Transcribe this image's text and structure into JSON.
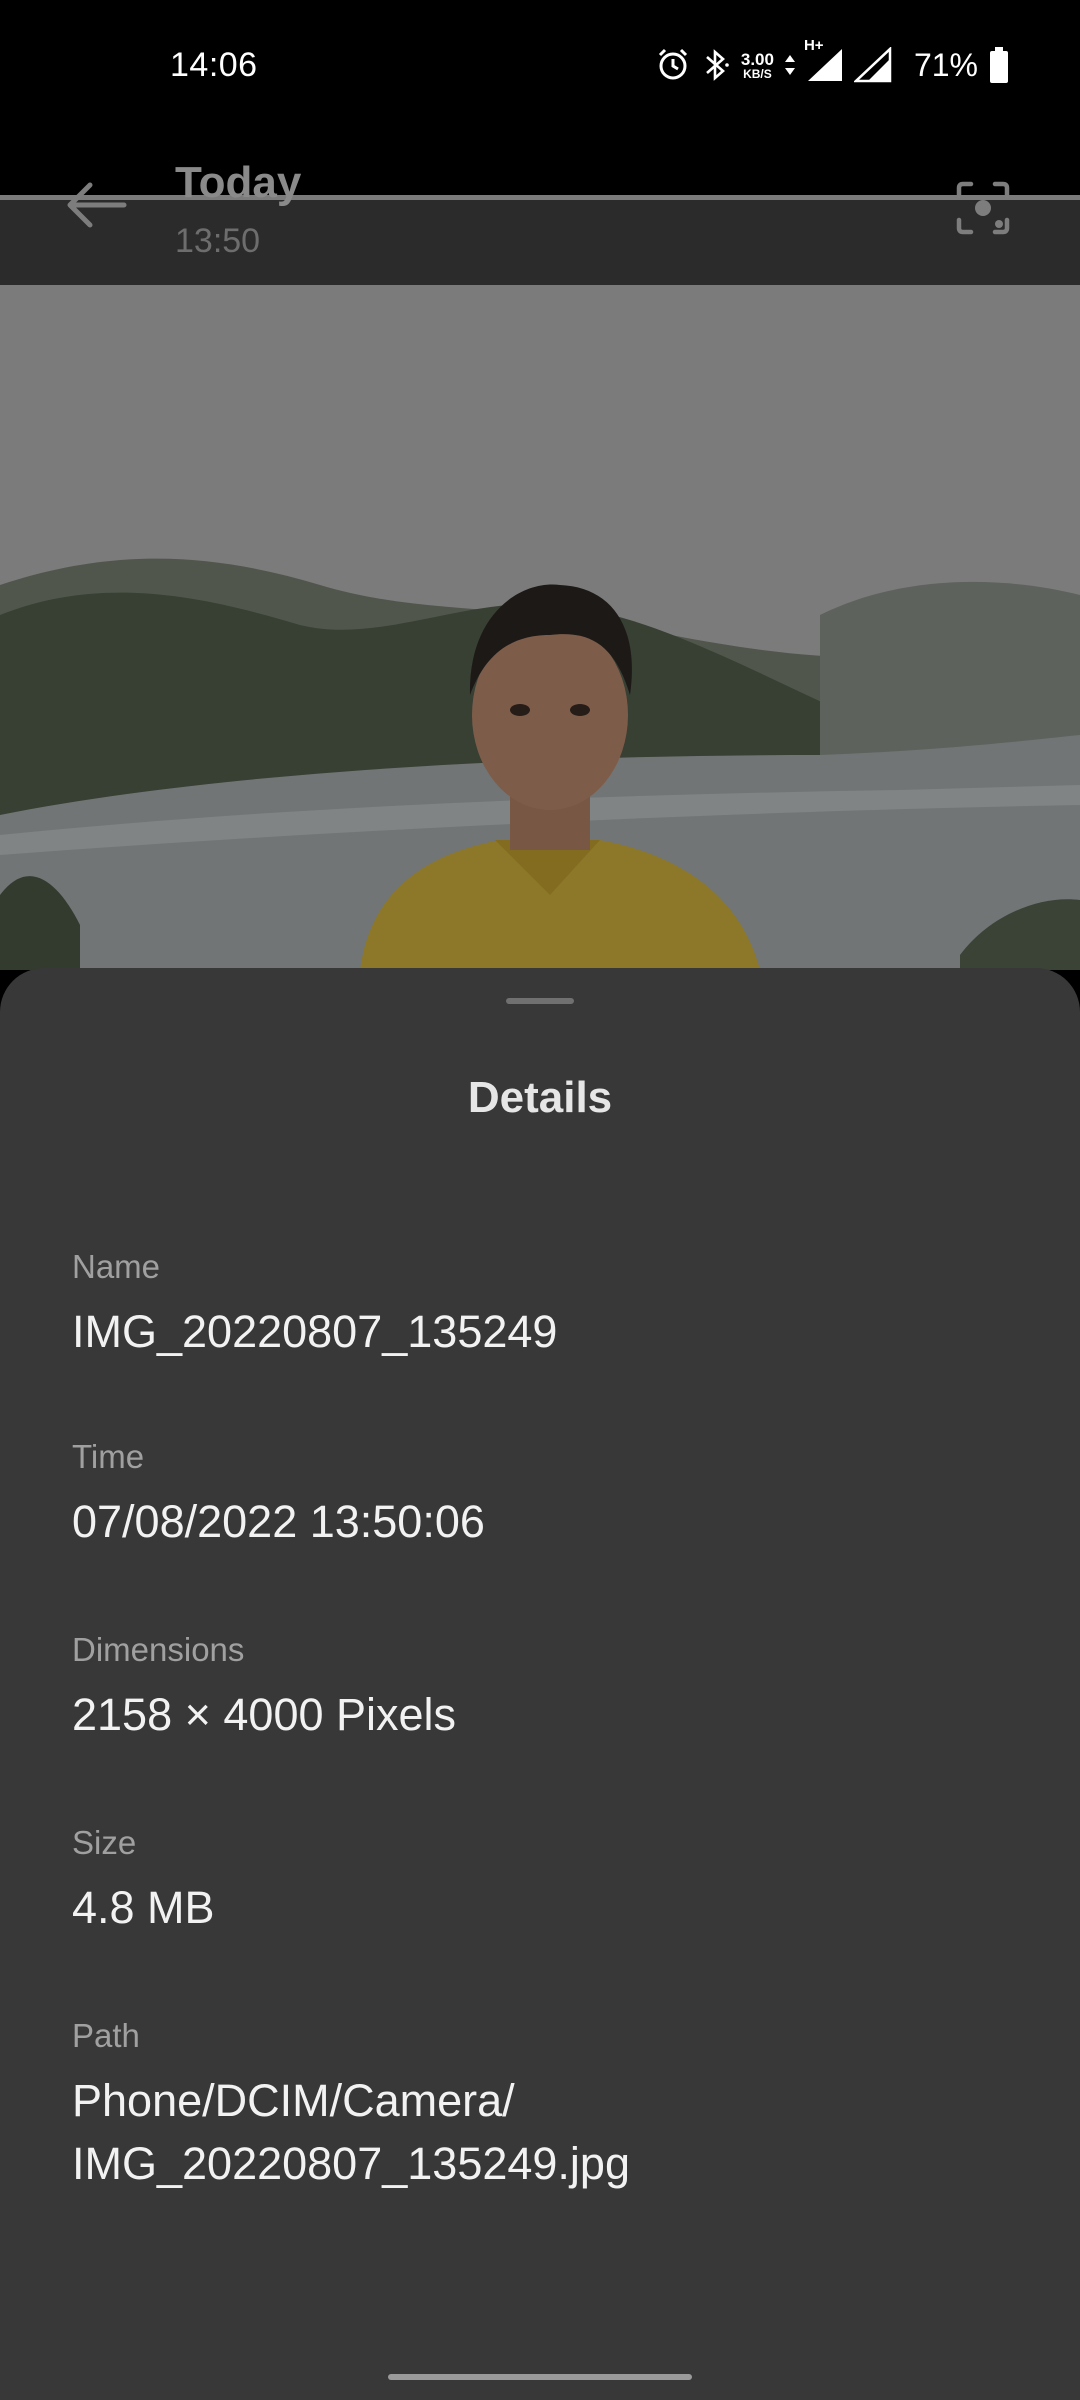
{
  "status_bar": {
    "time": "14:06",
    "net_speed_value": "3.00",
    "net_speed_unit": "KB/S",
    "network_type": "H+",
    "battery": "71%",
    "icons": [
      "alarm-icon",
      "bluetooth-icon",
      "data-arrows-icon",
      "signal-icon",
      "signal-icon",
      "battery-icon"
    ]
  },
  "app_bar": {
    "title": "Today",
    "subtitle": "13:50",
    "back_icon": "arrow-left-icon",
    "action_icon": "lens-scan-icon"
  },
  "photo": {
    "description_icon": "photo"
  },
  "details": {
    "title": "Details",
    "fields": [
      {
        "label": "Name",
        "value": "IMG_20220807_135249"
      },
      {
        "label": "Time",
        "value": "07/08/2022 13:50:06"
      },
      {
        "label": "Dimensions",
        "value": "2158 × 4000 Pixels"
      },
      {
        "label": "Size",
        "value": "4.8 MB"
      },
      {
        "label": "Path",
        "value_line1": "Phone/DCIM/Camera/",
        "value_line2": "IMG_20220807_135249.jpg"
      }
    ]
  }
}
